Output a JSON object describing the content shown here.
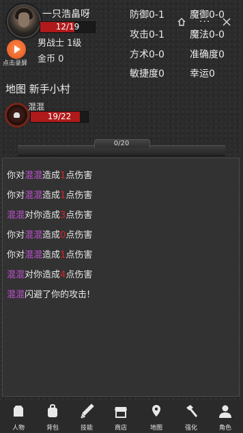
{
  "player": {
    "name": "一只浩畠呀",
    "hp_text": "12/19",
    "hp_fraction": 0.63,
    "class_level": "男战士 1级",
    "gold": "金币 0"
  },
  "record": {
    "label": "点击录屏"
  },
  "stats": {
    "defense": "防御0-1",
    "magic_defense": "魔御0-0",
    "attack": "攻击0-1",
    "magic": "魔法0-0",
    "technique": "方术0-0",
    "accuracy": "准确度0",
    "agility": "敏捷度0",
    "luck": "幸运0"
  },
  "capsule": {
    "dots": "···"
  },
  "map": {
    "label": "地图 新手小村"
  },
  "enemy": {
    "name": "混混",
    "hp_text": "19/22",
    "hp_fraction": 0.86
  },
  "progress": {
    "text": "0/20"
  },
  "log": [
    {
      "parts": [
        {
          "t": "你对",
          "c": "normal"
        },
        {
          "t": "混混",
          "c": "enemy"
        },
        {
          "t": "造成",
          "c": "normal"
        },
        {
          "t": "1",
          "c": "dmg"
        },
        {
          "t": "点伤害",
          "c": "normal"
        }
      ]
    },
    {
      "parts": [
        {
          "t": "你对",
          "c": "normal"
        },
        {
          "t": "混混",
          "c": "enemy"
        },
        {
          "t": "造成",
          "c": "normal"
        },
        {
          "t": "1",
          "c": "dmg"
        },
        {
          "t": "点伤害",
          "c": "normal"
        }
      ]
    },
    {
      "parts": [
        {
          "t": "混混",
          "c": "enemy"
        },
        {
          "t": "对你造成",
          "c": "normal"
        },
        {
          "t": "3",
          "c": "dmg"
        },
        {
          "t": "点伤害",
          "c": "normal"
        }
      ]
    },
    {
      "parts": [
        {
          "t": "你对",
          "c": "normal"
        },
        {
          "t": "混混",
          "c": "enemy"
        },
        {
          "t": "造成",
          "c": "normal"
        },
        {
          "t": "0",
          "c": "dmg"
        },
        {
          "t": "点伤害",
          "c": "normal"
        }
      ]
    },
    {
      "parts": [
        {
          "t": "你对",
          "c": "normal"
        },
        {
          "t": "混混",
          "c": "enemy"
        },
        {
          "t": "造成",
          "c": "normal"
        },
        {
          "t": "1",
          "c": "dmg"
        },
        {
          "t": "点伤害",
          "c": "normal"
        }
      ]
    },
    {
      "parts": [
        {
          "t": "混混",
          "c": "enemy"
        },
        {
          "t": "对你造成",
          "c": "normal"
        },
        {
          "t": "4",
          "c": "dmg"
        },
        {
          "t": "点伤害",
          "c": "normal"
        }
      ]
    },
    {
      "parts": [
        {
          "t": "混混",
          "c": "enemy"
        },
        {
          "t": "闪避了你的攻击!",
          "c": "normal"
        }
      ]
    }
  ],
  "nav": [
    {
      "label": "人物",
      "icon": "character-icon"
    },
    {
      "label": "背包",
      "icon": "backpack-icon"
    },
    {
      "label": "技能",
      "icon": "sword-icon"
    },
    {
      "label": "商店",
      "icon": "shop-icon"
    },
    {
      "label": "地图",
      "icon": "map-icon"
    },
    {
      "label": "强化",
      "icon": "hammer-icon"
    },
    {
      "label": "角色",
      "icon": "user-icon"
    }
  ],
  "colors": {
    "enemy_name": "#c452d6",
    "damage": "#d8252a",
    "hp_fill": "#b01a1a",
    "record_button": "#e0521c"
  }
}
